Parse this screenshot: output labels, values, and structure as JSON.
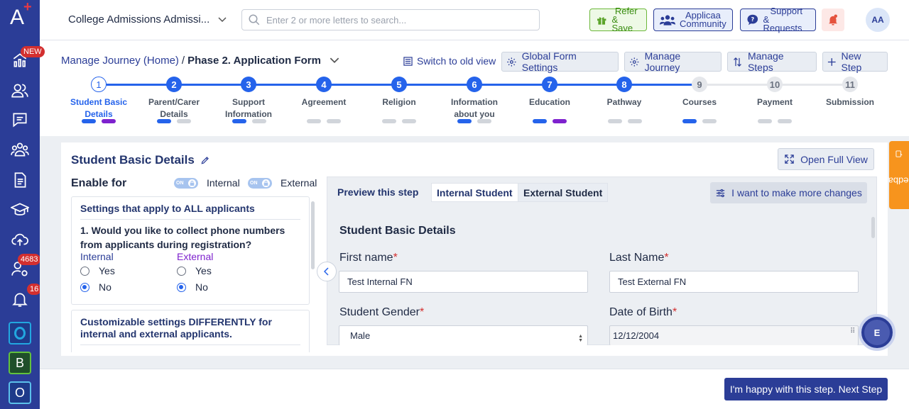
{
  "colors": {
    "primary": "#2b3d97",
    "accent": "#2563eb",
    "purple": "#7e22ce",
    "required": "#d32f2f",
    "feedback": "#f7941d"
  },
  "sidebar": {
    "logo": "A",
    "badges": {
      "new": "NEW",
      "users": "4683",
      "notifications": "16"
    },
    "apps": [
      "O",
      "B",
      "O"
    ]
  },
  "topbar": {
    "institution": "College Admissions Admissi...",
    "search_placeholder": "Enter 2 or more letters to search...",
    "refer_line1": "Refer",
    "refer_line2": "& Save",
    "community_line1": "Applicaa",
    "community_line2": "Community",
    "support_line1": "Support",
    "support_line2": "& Requests",
    "avatar_initials": "AA"
  },
  "breadcrumb": {
    "home": "Manage Journey (Home)",
    "separator": "/",
    "current": "Phase 2. Application Form"
  },
  "actions": {
    "switch_old": "Switch to old view",
    "global_settings": "Global Form Settings",
    "manage_journey": "Manage Journey",
    "manage_steps": "Manage Steps",
    "new_step": "New Step"
  },
  "steps": [
    {
      "num": "1",
      "line1": "Student Basic",
      "line2": "Details"
    },
    {
      "num": "2",
      "line1": "Parent/Carer",
      "line2": "Details"
    },
    {
      "num": "3",
      "line1": "Support",
      "line2": "Information"
    },
    {
      "num": "4",
      "line1": "Agreement",
      "line2": ""
    },
    {
      "num": "5",
      "line1": "Religion",
      "line2": ""
    },
    {
      "num": "6",
      "line1": "Information",
      "line2": "about you"
    },
    {
      "num": "7",
      "line1": "Education",
      "line2": ""
    },
    {
      "num": "8",
      "line1": "Pathway",
      "line2": ""
    },
    {
      "num": "9",
      "line1": "Courses",
      "line2": ""
    },
    {
      "num": "10",
      "line1": "Payment",
      "line2": ""
    },
    {
      "num": "11",
      "line1": "Submission",
      "line2": ""
    }
  ],
  "panel": {
    "title": "Student Basic Details",
    "open_full_view": "Open Full View",
    "enable_for": "Enable for",
    "toggle_on": "ON",
    "internal": "Internal",
    "external": "External"
  },
  "settings_all": {
    "heading": "Settings that apply to ALL applicants",
    "question": "1. Would you like to collect phone numbers from applicants during registration?",
    "col_internal": "Internal",
    "col_external": "External",
    "yes": "Yes",
    "no": "No",
    "internal_selected": "No",
    "external_selected": "No"
  },
  "settings_diff": {
    "heading": "Customizable settings DIFFERENTLY for internal and external applicants."
  },
  "preview": {
    "title": "Preview this step",
    "tab_internal": "Internal Student",
    "tab_external": "External Student",
    "more_changes": "I want to make more changes",
    "section": "Student Basic Details",
    "first_name_label": "First name",
    "first_name_value": "Test Internal FN",
    "last_name_label": "Last Name",
    "last_name_value": "Test External FN",
    "gender_label": "Student Gender",
    "gender_value": "Male",
    "dob_label": "Date of Birth",
    "dob_value": "12/12/2004",
    "required_mark": "*"
  },
  "floating": {
    "chat_initial": "E",
    "feedback": "Feedback"
  },
  "footer": {
    "next": "I'm happy with this step. Next Step"
  }
}
